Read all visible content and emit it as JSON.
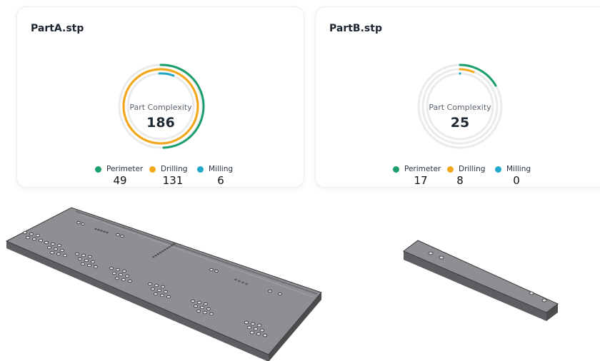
{
  "cards": [
    {
      "file_name": "PartA.stp",
      "complexity_label": "Part Complexity",
      "complexity_value": "186",
      "perimeter": {
        "label": "Perimeter",
        "value": "49"
      },
      "drilling": {
        "label": "Drilling",
        "value": "131"
      },
      "milling": {
        "label": "Milling",
        "value": "6"
      }
    },
    {
      "file_name": "PartB.stp",
      "complexity_label": "Part Complexity",
      "complexity_value": "25",
      "perimeter": {
        "label": "Perimeter",
        "value": "17"
      },
      "drilling": {
        "label": "Drilling",
        "value": "8"
      },
      "milling": {
        "label": "Milling",
        "value": "0"
      }
    }
  ],
  "colors": {
    "perimeter": "#1a9e6a",
    "drilling": "#f2a81d",
    "milling": "#21a7c9",
    "track": "#e9ebee",
    "part_top": "#8d8f92",
    "part_side": "#5c5e61",
    "part_edge": "#3a3b3d"
  },
  "icons": [
    "perimeter-dot",
    "drilling-dot",
    "milling-dot"
  ]
}
